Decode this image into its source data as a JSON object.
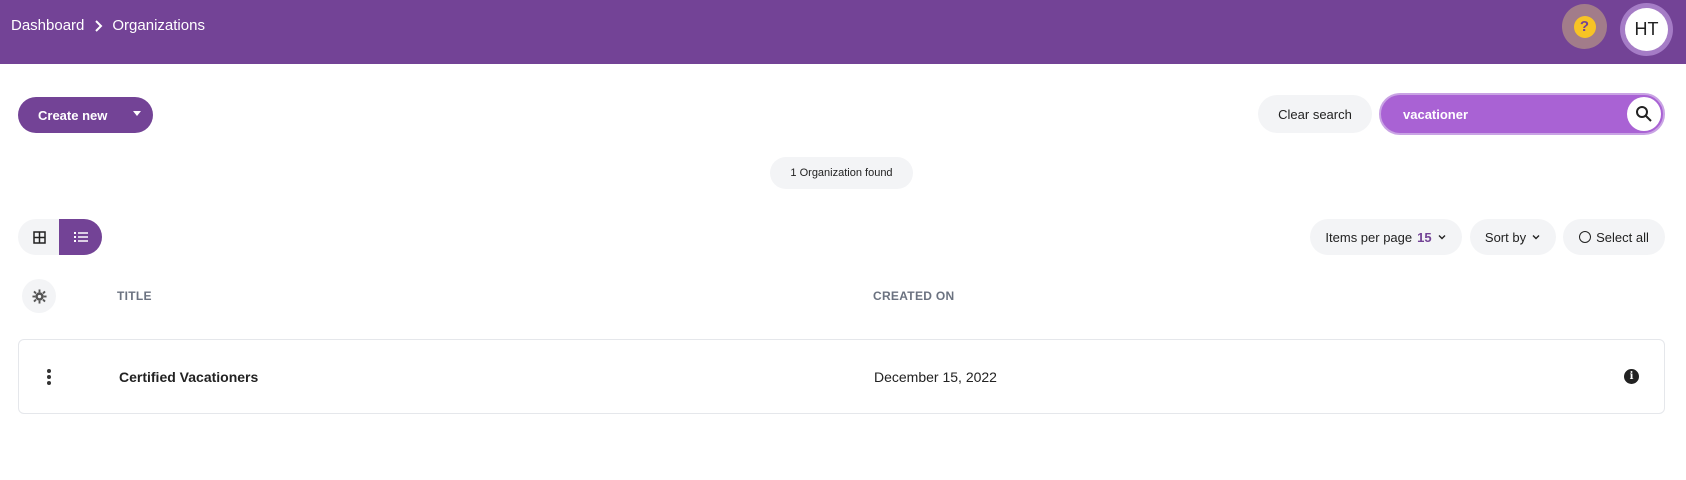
{
  "header": {
    "breadcrumb": [
      "Dashboard",
      "Organizations"
    ],
    "help_icon": "question-mark-icon",
    "avatar_initials": "HT",
    "bg_color": "#734396"
  },
  "toolbar": {
    "create_label": "Create new",
    "clear_search_label": "Clear search",
    "search_value": "vacationer"
  },
  "results": {
    "count_label": "1 Organization found"
  },
  "controls": {
    "items_per_page_label": "Items per page",
    "items_per_page_value": "15",
    "sort_by_label": "Sort by",
    "select_all_label": "Select all",
    "active_view": "list"
  },
  "table": {
    "columns": [
      "TITLE",
      "CREATED ON"
    ],
    "rows": [
      {
        "title": "Certified Vacationers",
        "created_on": "December 15, 2022"
      }
    ]
  }
}
